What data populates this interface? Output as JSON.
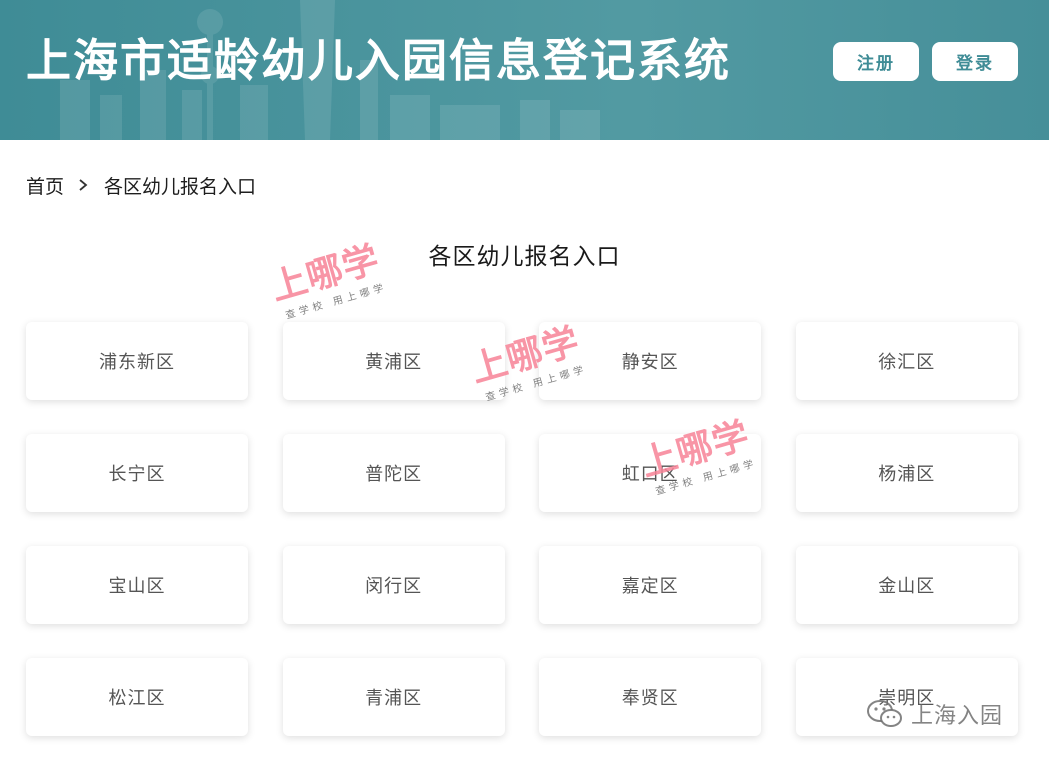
{
  "header": {
    "title": "上海市适龄幼儿入园信息登记系统",
    "register_label": "注册",
    "login_label": "登录",
    "accent_color": "#3f8c96"
  },
  "breadcrumb": {
    "home": "首页",
    "current": "各区幼儿报名入口"
  },
  "section_title": "各区幼儿报名入口",
  "districts": [
    "浦东新区",
    "黄浦区",
    "静安区",
    "徐汇区",
    "长宁区",
    "普陀区",
    "虹口区",
    "杨浦区",
    "宝山区",
    "闵行区",
    "嘉定区",
    "金山区",
    "松江区",
    "青浦区",
    "奉贤区",
    "崇明区"
  ],
  "watermark": {
    "main": "上哪学",
    "sub": "查学校 用上哪学"
  },
  "brand_overlay": {
    "text": "上海入园",
    "icon": "wechat-icon"
  }
}
